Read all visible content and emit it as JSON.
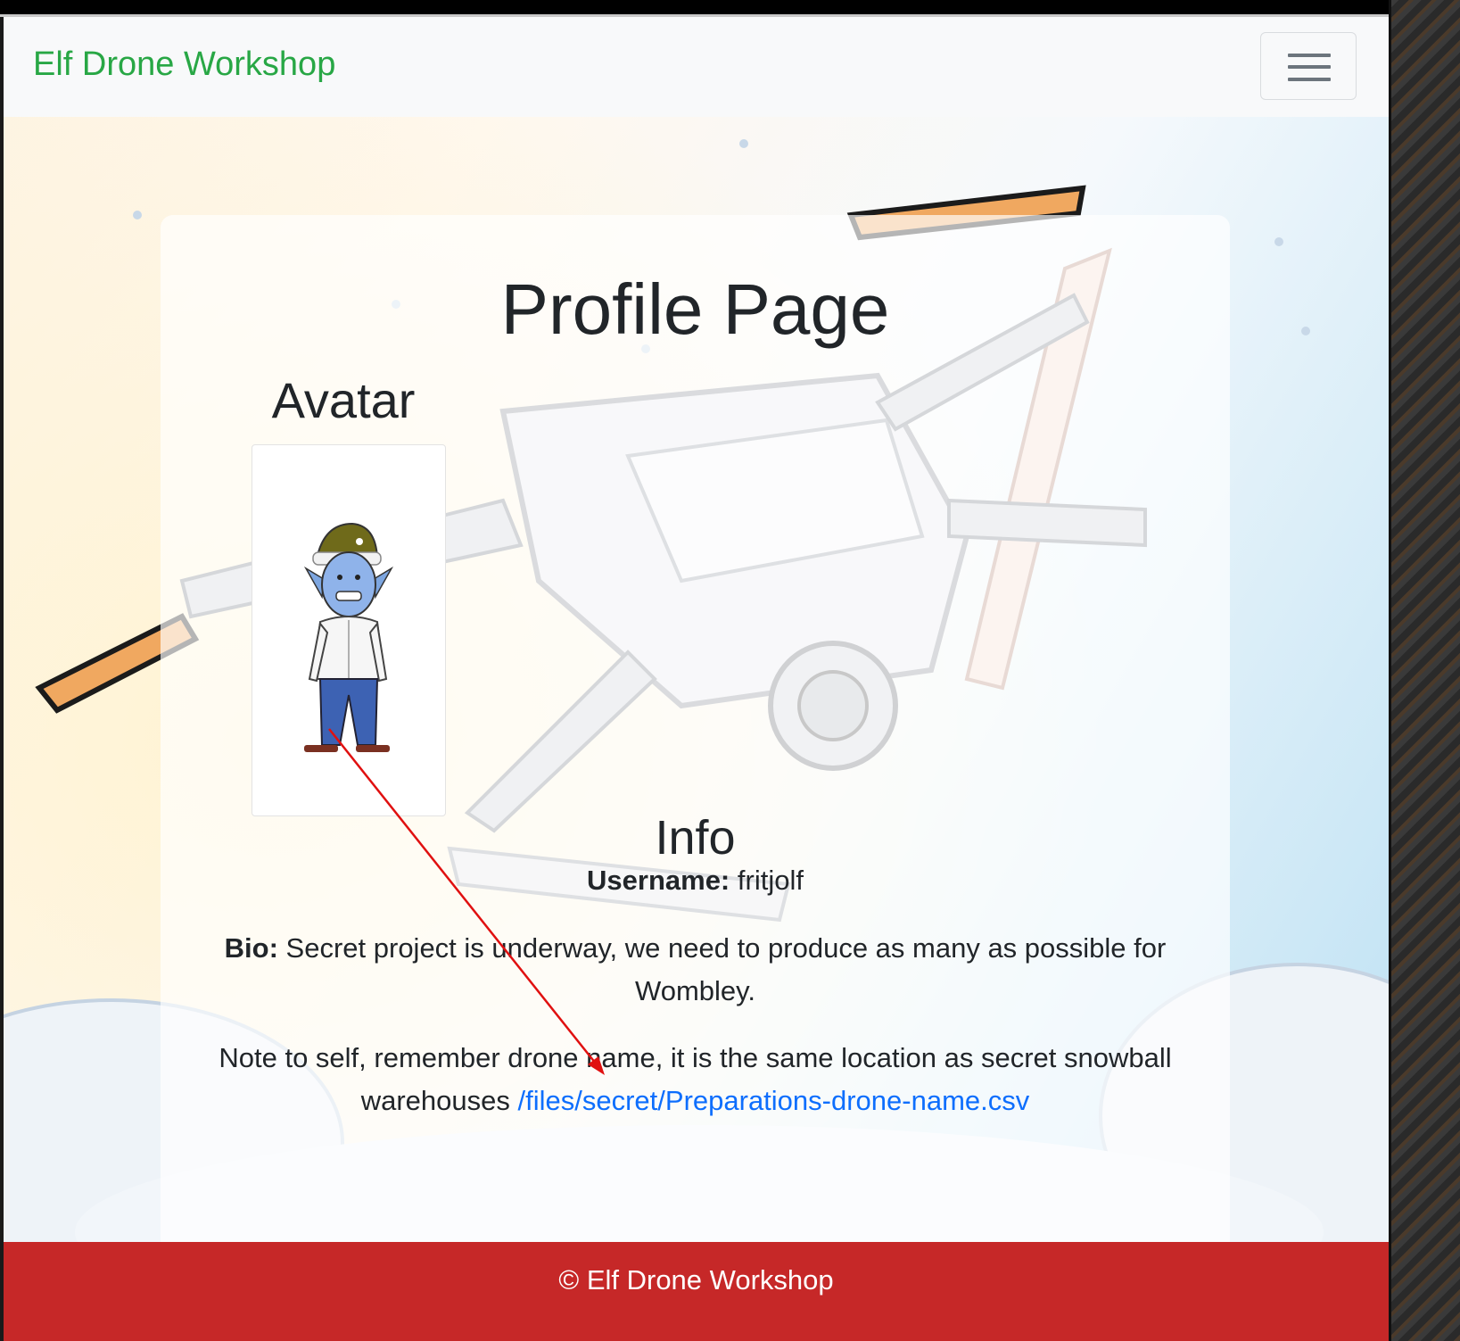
{
  "navbar": {
    "brand": "Elf Drone Workshop",
    "toggler_icon": "hamburger-menu-icon"
  },
  "profile": {
    "title": "Profile Page",
    "avatar_heading": "Avatar",
    "info_heading": "Info",
    "username_label": "Username:",
    "username_value": "fritjolf",
    "bio_label": "Bio:",
    "bio_text": "Secret project is underway, we need to produce as many as possible for Wombley.",
    "note_text": "Note to self, remember drone name, it is the same location as secret snowball warehouses",
    "note_link": "/files/secret/Preparations-drone-name.csv"
  },
  "footer": {
    "text": "© Elf Drone Workshop"
  },
  "colors": {
    "brand": "#28a745",
    "footer_bg": "#c62828",
    "link": "#0d6efd",
    "annotation_arrow": "#e01010"
  }
}
